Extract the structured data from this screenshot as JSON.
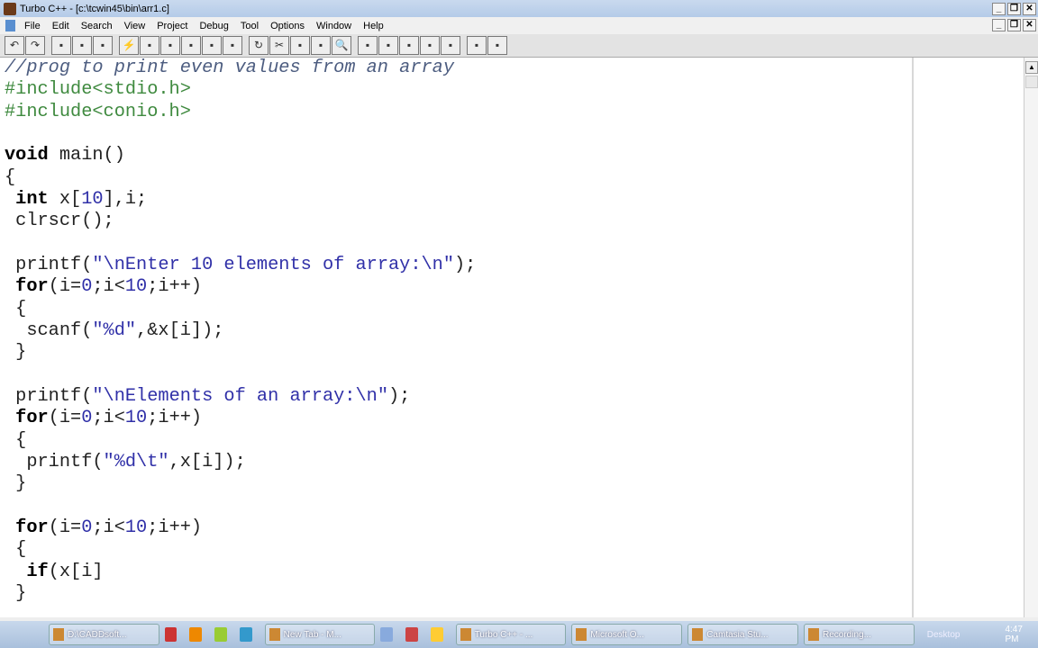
{
  "window": {
    "title": "Turbo C++ - [c:\\tcwin45\\bin\\arr1.c]",
    "minimize": "_",
    "restore": "❐",
    "close": "✕"
  },
  "menu": [
    "File",
    "Edit",
    "Search",
    "View",
    "Project",
    "Debug",
    "Tool",
    "Options",
    "Window",
    "Help"
  ],
  "toolbar_icons": [
    "undo-icon",
    "redo-icon",
    "open-project-icon",
    "open-file-icon",
    "save-file-icon",
    "compile-icon",
    "make-icon",
    "step-over-icon",
    "trace-into-icon",
    "breakpoint-icon",
    "inspect-icon",
    "run-icon",
    "cut-icon",
    "copy-icon",
    "paste-icon",
    "search-icon",
    "search-next-icon",
    "replace-icon",
    "find-icon",
    "add-watch-icon",
    "add-item-icon",
    "tile-icon",
    "cascade-icon"
  ],
  "colors": {
    "comment": "#4d5d80",
    "preprocessor": "#3f8a3f",
    "string": "#3030a8"
  },
  "code": [
    [
      [
        "comment",
        "//prog to print even values from an array"
      ]
    ],
    [
      [
        "pre",
        "#include<stdio.h>"
      ]
    ],
    [
      [
        "pre",
        "#include<conio.h>"
      ]
    ],
    [],
    [
      [
        "kw",
        "void"
      ],
      [
        "t",
        " main()"
      ]
    ],
    [
      [
        "t",
        "{"
      ]
    ],
    [
      [
        "t",
        " "
      ],
      [
        "kw",
        "int"
      ],
      [
        "t",
        " x["
      ],
      [
        "num",
        "10"
      ],
      [
        "t",
        "],i;"
      ]
    ],
    [
      [
        "t",
        " clrscr();"
      ]
    ],
    [],
    [
      [
        "t",
        " printf("
      ],
      [
        "str",
        "\"\\nEnter 10 elements of array:\\n\""
      ],
      [
        "t",
        ");"
      ]
    ],
    [
      [
        "t",
        " "
      ],
      [
        "kw",
        "for"
      ],
      [
        "t",
        "(i="
      ],
      [
        "num",
        "0"
      ],
      [
        "t",
        ";i<"
      ],
      [
        "num",
        "10"
      ],
      [
        "t",
        ";i++)"
      ]
    ],
    [
      [
        "t",
        " {"
      ]
    ],
    [
      [
        "t",
        "  scanf("
      ],
      [
        "str",
        "\"%d\""
      ],
      [
        "t",
        ",&x[i]);"
      ]
    ],
    [
      [
        "t",
        " }"
      ]
    ],
    [],
    [
      [
        "t",
        " printf("
      ],
      [
        "str",
        "\"\\nElements of an array:\\n\""
      ],
      [
        "t",
        ");"
      ]
    ],
    [
      [
        "t",
        " "
      ],
      [
        "kw",
        "for"
      ],
      [
        "t",
        "(i="
      ],
      [
        "num",
        "0"
      ],
      [
        "t",
        ";i<"
      ],
      [
        "num",
        "10"
      ],
      [
        "t",
        ";i++)"
      ]
    ],
    [
      [
        "t",
        " {"
      ]
    ],
    [
      [
        "t",
        "  printf("
      ],
      [
        "str",
        "\"%d\\t\""
      ],
      [
        "t",
        ",x[i]);"
      ]
    ],
    [
      [
        "t",
        " }"
      ]
    ],
    [],
    [
      [
        "t",
        " "
      ],
      [
        "kw",
        "for"
      ],
      [
        "t",
        "(i="
      ],
      [
        "num",
        "0"
      ],
      [
        "t",
        ";i<"
      ],
      [
        "num",
        "10"
      ],
      [
        "t",
        ";i++)"
      ]
    ],
    [
      [
        "t",
        " {"
      ]
    ],
    [
      [
        "t",
        "  "
      ],
      [
        "kw",
        "if"
      ],
      [
        "t",
        "(x[i]"
      ]
    ],
    [
      [
        "t",
        " }"
      ]
    ]
  ],
  "taskbar": {
    "tasks": [
      "D:\\CADDsoft...",
      "New Tab - M...",
      "Turbo C++ - ...",
      "Microsoft O...",
      "Camtasia Stu...",
      "Recording..."
    ],
    "desktop": "Desktop",
    "clock": "4:47 PM"
  }
}
